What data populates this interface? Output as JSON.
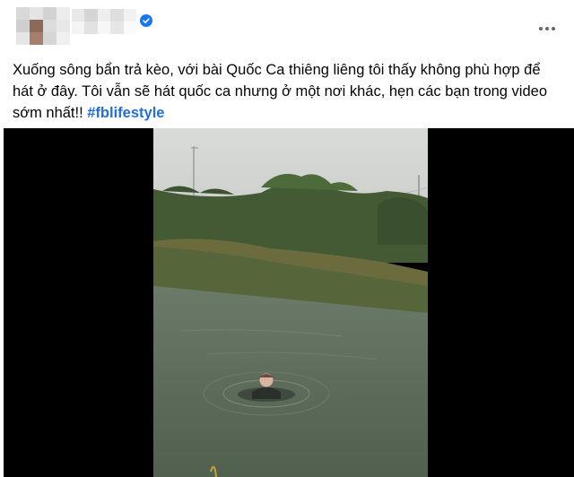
{
  "post": {
    "author_verified": true,
    "more_options_label": "...",
    "caption_text": "Xuống sông bẩn trả kèo, với bài Quốc Ca thiêng liêng tôi thấy không phù hợp để hát ở đây. Tôi vẫn sẽ hát quốc ca nhưng ở một nơi khác, hẹn các bạn trong video sớm nhất!! ",
    "hashtag": "#fblifestyle",
    "colors": {
      "verified_badge": "#1877f2",
      "hashtag": "#216fdb",
      "video_background": "#000000"
    },
    "icons": {
      "verified": "verified-check-icon",
      "more": "more-horizontal-icon"
    }
  }
}
